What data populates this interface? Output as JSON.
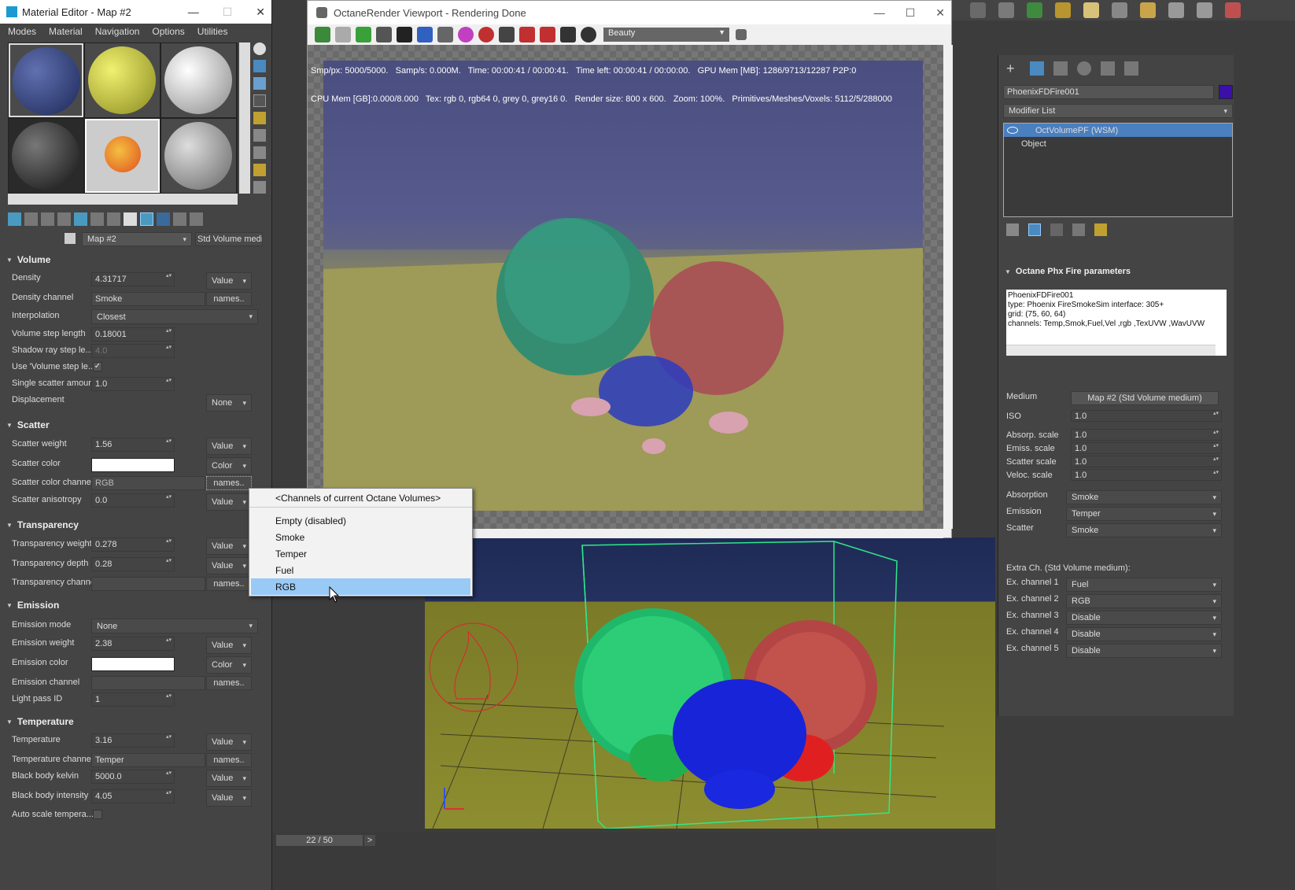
{
  "material_editor": {
    "title": "Material Editor - Map #2",
    "menus": [
      "Modes",
      "Material",
      "Navigation",
      "Options",
      "Utilities"
    ],
    "map_name": "Map #2",
    "map_type": "Std Volume mediur",
    "sections": {
      "volume": "Volume",
      "scatter": "Scatter",
      "transparency": "Transparency",
      "emission": "Emission",
      "temperature": "Temperature"
    },
    "volume": {
      "density_label": "Density",
      "density": "4.31717",
      "density_mode": "Value",
      "density_channel_label": "Density channel",
      "density_channel": "Smoke",
      "names_btn": "names..",
      "interpolation_label": "Interpolation",
      "interpolation": "Closest",
      "step_label": "Volume step length",
      "step": "0.18001",
      "shadow_label": "Shadow ray step le...",
      "shadow": "4.0",
      "use_step_label": "Use 'Volume step le...",
      "single_scatter_label": "Single scatter amount",
      "single_scatter": "1.0",
      "displacement_label": "Displacement",
      "displacement": "None"
    },
    "scatter": {
      "weight_label": "Scatter weight",
      "weight": "1.56",
      "weight_mode": "Value",
      "color_label": "Scatter color",
      "color_mode": "Color",
      "channel_label": "Scatter color channel",
      "channel": "RGB",
      "aniso_label": "Scatter anisotropy",
      "aniso": "0.0",
      "aniso_mode": "Value"
    },
    "transparency": {
      "weight_label": "Transparency weight",
      "weight": "0.278",
      "weight_mode": "Value",
      "depth_label": "Transparency depth",
      "depth": "0.28",
      "depth_mode": "Value",
      "channel_label": "Transparency channel"
    },
    "emission": {
      "mode_label": "Emission mode",
      "mode": "None",
      "weight_label": "Emission weight",
      "weight": "2.38",
      "weight_mode": "Value",
      "color_label": "Emission color",
      "color_mode": "Color",
      "channel_label": "Emission channel",
      "lightpass_label": "Light pass ID",
      "lightpass": "1"
    },
    "temperature": {
      "temp_label": "Temperature",
      "temp": "3.16",
      "temp_mode": "Value",
      "channel_label": "Temperature channel",
      "channel": "Temper",
      "kelvin_label": "Black body kelvin",
      "kelvin": "5000.0",
      "kelvin_mode": "Value",
      "intensity_label": "Black body intensity",
      "intensity": "4.05",
      "intensity_mode": "Value",
      "autoscale_label": "Auto scale tempera..."
    }
  },
  "channel_menu": {
    "header": "<Channels of current Octane Volumes>",
    "items": [
      "Empty (disabled)",
      "Smoke",
      "Temper",
      "Fuel",
      "RGB"
    ],
    "selected": "RGB"
  },
  "viewport": {
    "title": "OctaneRender Viewport - Rendering Done",
    "pass": "Beauty",
    "stats1": "Smp/px: 5000/5000.   Samp/s: 0.000M.   Time: 00:00:41 / 00:00:41.   Time left: 00:00:41 / 00:00:00.   GPU Mem [MB]: 1286/9713/12287 P2P:0",
    "stats2": "CPU Mem [GB]:0.000/8.000   Tex: rgb 0, rgb64 0, grey 0, grey16 0.   Render size: 800 x 600.   Zoom: 100%.   Primitives/Meshes/Voxels: 5112/5/288000"
  },
  "timeline": {
    "frame": "22 / 50",
    "next": ">"
  },
  "command_panel": {
    "object_name": "PhoenixFDFire001",
    "modifier_list": "Modifier List",
    "stack": [
      "OctVolumePF (WSM)",
      "Object"
    ],
    "rollout": "Octane Phx Fire parameters",
    "info": [
      "PhoenixFDFire001",
      "type: Phoenix FireSmokeSim    interface: 305+",
      "grid: (75, 60, 64)",
      "channels: Temp,Smok,Fuel,Vel ,rgb ,TexUVW ,WavUVW"
    ],
    "medium_label": "Medium",
    "medium": "Map #2 (Std Volume medium)",
    "iso_label": "ISO",
    "iso": "1.0",
    "absorp_label": "Absorp. scale",
    "absorp": "1.0",
    "emiss_label": "Emiss. scale",
    "emiss": "1.0",
    "scatter_label": "Scatter scale",
    "scatter": "1.0",
    "veloc_label": "Veloc. scale",
    "veloc": "1.0",
    "absorption_label": "Absorption",
    "absorption": "Smoke",
    "emission_label": "Emission",
    "emission": "Temper",
    "scatter_ch_label": "Scatter",
    "scatter_ch": "Smoke",
    "extra_label": "Extra Ch. (Std Volume medium):",
    "ex1_label": "Ex. channel 1",
    "ex1": "Fuel",
    "ex2_label": "Ex. channel 2",
    "ex2": "RGB",
    "ex3_label": "Ex. channel 3",
    "ex3": "Disable",
    "ex4_label": "Ex. channel 4",
    "ex4": "Disable",
    "ex5_label": "Ex. channel 5",
    "ex5": "Disable"
  },
  "colors": {
    "accent": "#2f7fd6",
    "selection": "#99c9f5",
    "panel": "#444444"
  }
}
